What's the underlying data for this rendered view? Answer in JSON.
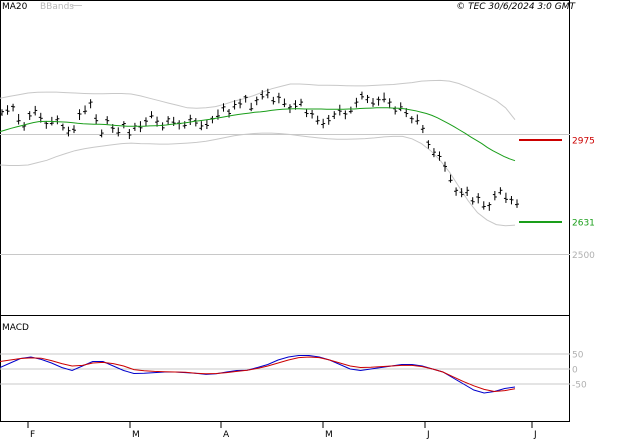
{
  "header": {
    "legend": [
      {
        "label": "MA20",
        "color": "#1a9e1a"
      },
      {
        "label": "BBands",
        "color": "#b8b8b8"
      }
    ],
    "copyright": "© TEC 30/6/2024 3:0 GMT"
  },
  "colors": {
    "price_bars": "#000000",
    "ma20": "#1a9e1a",
    "bbands": "#c8c8c8",
    "resistance": "#cc0000",
    "support": "#1a9e1a",
    "macd": "#0000cc",
    "signal": "#cc0000",
    "grid": "#c8c8c8"
  },
  "chart_data": [
    {
      "type": "ohlc",
      "title": "",
      "y_ticks": [
        2500
      ],
      "y_tick_labels": [
        "2500"
      ],
      "ylim": [
        2420,
        3210
      ],
      "x_labels": [
        "F",
        "M",
        "A",
        "M",
        "J",
        "J"
      ],
      "levels": [
        {
          "name": "resistance",
          "value": 2975,
          "label": "2975",
          "color": "#cc0000"
        },
        {
          "name": "support",
          "value": 2631,
          "label": "2631",
          "color": "#1a9e1a"
        }
      ],
      "series": [
        {
          "name": "price",
          "values": [
            3090,
            3100,
            3110,
            3060,
            3030,
            3080,
            3095,
            3070,
            3040,
            3050,
            3060,
            3030,
            3010,
            3020,
            3080,
            3100,
            3130,
            3060,
            3000,
            3060,
            3020,
            3010,
            3040,
            3000,
            3030,
            3030,
            3050,
            3080,
            3050,
            3030,
            3060,
            3050,
            3040,
            3040,
            3060,
            3050,
            3030,
            3040,
            3060,
            3080,
            3110,
            3090,
            3120,
            3130,
            3150,
            3110,
            3140,
            3160,
            3170,
            3140,
            3150,
            3130,
            3110,
            3120,
            3130,
            3090,
            3080,
            3060,
            3040,
            3060,
            3080,
            3100,
            3080,
            3100,
            3130,
            3160,
            3150,
            3130,
            3140,
            3150,
            3130,
            3100,
            3110,
            3090,
            3060,
            3060,
            3020,
            2960,
            2920,
            2910,
            2860,
            2810,
            2760,
            2750,
            2760,
            2720,
            2730,
            2700,
            2700,
            2740,
            2760,
            2730,
            2720,
            2710
          ]
        },
        {
          "name": "MA20",
          "values": [
            3010,
            3017,
            3024,
            3030,
            3036,
            3042,
            3048,
            3052,
            3053,
            3053,
            3052,
            3051,
            3050,
            3048,
            3045,
            3043,
            3042,
            3041,
            3041,
            3040,
            3038,
            3036,
            3034,
            3033,
            3033,
            3033,
            3033,
            3034,
            3035,
            3036,
            3038,
            3041,
            3043,
            3046,
            3049,
            3053,
            3056,
            3059,
            3062,
            3066,
            3070,
            3074,
            3078,
            3082,
            3085,
            3088,
            3091,
            3093,
            3096,
            3099,
            3102,
            3104,
            3105,
            3106,
            3106,
            3105,
            3105,
            3105,
            3105,
            3104,
            3104,
            3104,
            3104,
            3105,
            3105,
            3107,
            3108,
            3109,
            3110,
            3110,
            3110,
            3109,
            3108,
            3106,
            3102,
            3098,
            3092,
            3086,
            3078,
            3068,
            3056,
            3044,
            3031,
            3017,
            3003,
            2988,
            2974,
            2960,
            2944,
            2930,
            2918,
            2906,
            2896,
            2888
          ]
        },
        {
          "name": "BBands upper",
          "values": [
            3150,
            3158,
            3165,
            3172,
            3175,
            3176,
            3176,
            3174,
            3172,
            3170,
            3169,
            3169,
            3170,
            3170,
            3168,
            3160,
            3150,
            3140,
            3130,
            3120,
            3110,
            3108,
            3110,
            3115,
            3125,
            3138,
            3148,
            3160,
            3175,
            3190,
            3200,
            3210,
            3210,
            3208,
            3205,
            3205,
            3204,
            3203,
            3202,
            3202,
            3204,
            3206,
            3208,
            3212,
            3216,
            3222,
            3224,
            3225,
            3222,
            3212,
            3196,
            3178,
            3160,
            3140,
            3110,
            3060
          ]
        },
        {
          "name": "BBands lower",
          "values": [
            2870,
            2868,
            2868,
            2870,
            2880,
            2890,
            2905,
            2918,
            2930,
            2938,
            2945,
            2950,
            2955,
            2960,
            2962,
            2960,
            2959,
            2958,
            2958,
            2960,
            2962,
            2965,
            2970,
            2977,
            2985,
            2993,
            2998,
            3002,
            3004,
            3004,
            3002,
            2998,
            2993,
            2988,
            2984,
            2980,
            2978,
            2978,
            2979,
            2981,
            2984,
            2988,
            2990,
            2990,
            2980,
            2960,
            2930,
            2890,
            2840,
            2780,
            2720,
            2670,
            2640,
            2620,
            2615,
            2618
          ]
        }
      ]
    },
    {
      "type": "line",
      "title": "MACD",
      "y_ticks": [
        50,
        0,
        -50
      ],
      "y_tick_labels": [
        "50",
        "0",
        "-50"
      ],
      "ylim": [
        -85,
        75
      ],
      "x_labels": [
        "F",
        "M",
        "A",
        "M",
        "J",
        "J"
      ],
      "series": [
        {
          "name": "MACD",
          "values": [
            5,
            20,
            35,
            40,
            32,
            20,
            5,
            -5,
            10,
            25,
            25,
            10,
            -5,
            -15,
            -14,
            -12,
            -10,
            -10,
            -12,
            -14,
            -18,
            -16,
            -10,
            -5,
            -4,
            5,
            15,
            30,
            40,
            45,
            45,
            40,
            30,
            15,
            0,
            -5,
            0,
            5,
            10,
            15,
            15,
            10,
            0,
            -10,
            -30,
            -50,
            -70,
            -80,
            -75,
            -65,
            -60
          ]
        },
        {
          "name": "Signal",
          "values": [
            25,
            30,
            35,
            37,
            36,
            28,
            18,
            10,
            12,
            20,
            22,
            18,
            10,
            -2,
            -6,
            -8,
            -9,
            -10,
            -11,
            -14,
            -16,
            -15,
            -12,
            -8,
            -4,
            2,
            10,
            20,
            30,
            38,
            40,
            38,
            30,
            20,
            10,
            5,
            6,
            8,
            10,
            12,
            12,
            8,
            0,
            -10,
            -26,
            -42,
            -56,
            -68,
            -75,
            -72,
            -66
          ]
        }
      ]
    }
  ]
}
